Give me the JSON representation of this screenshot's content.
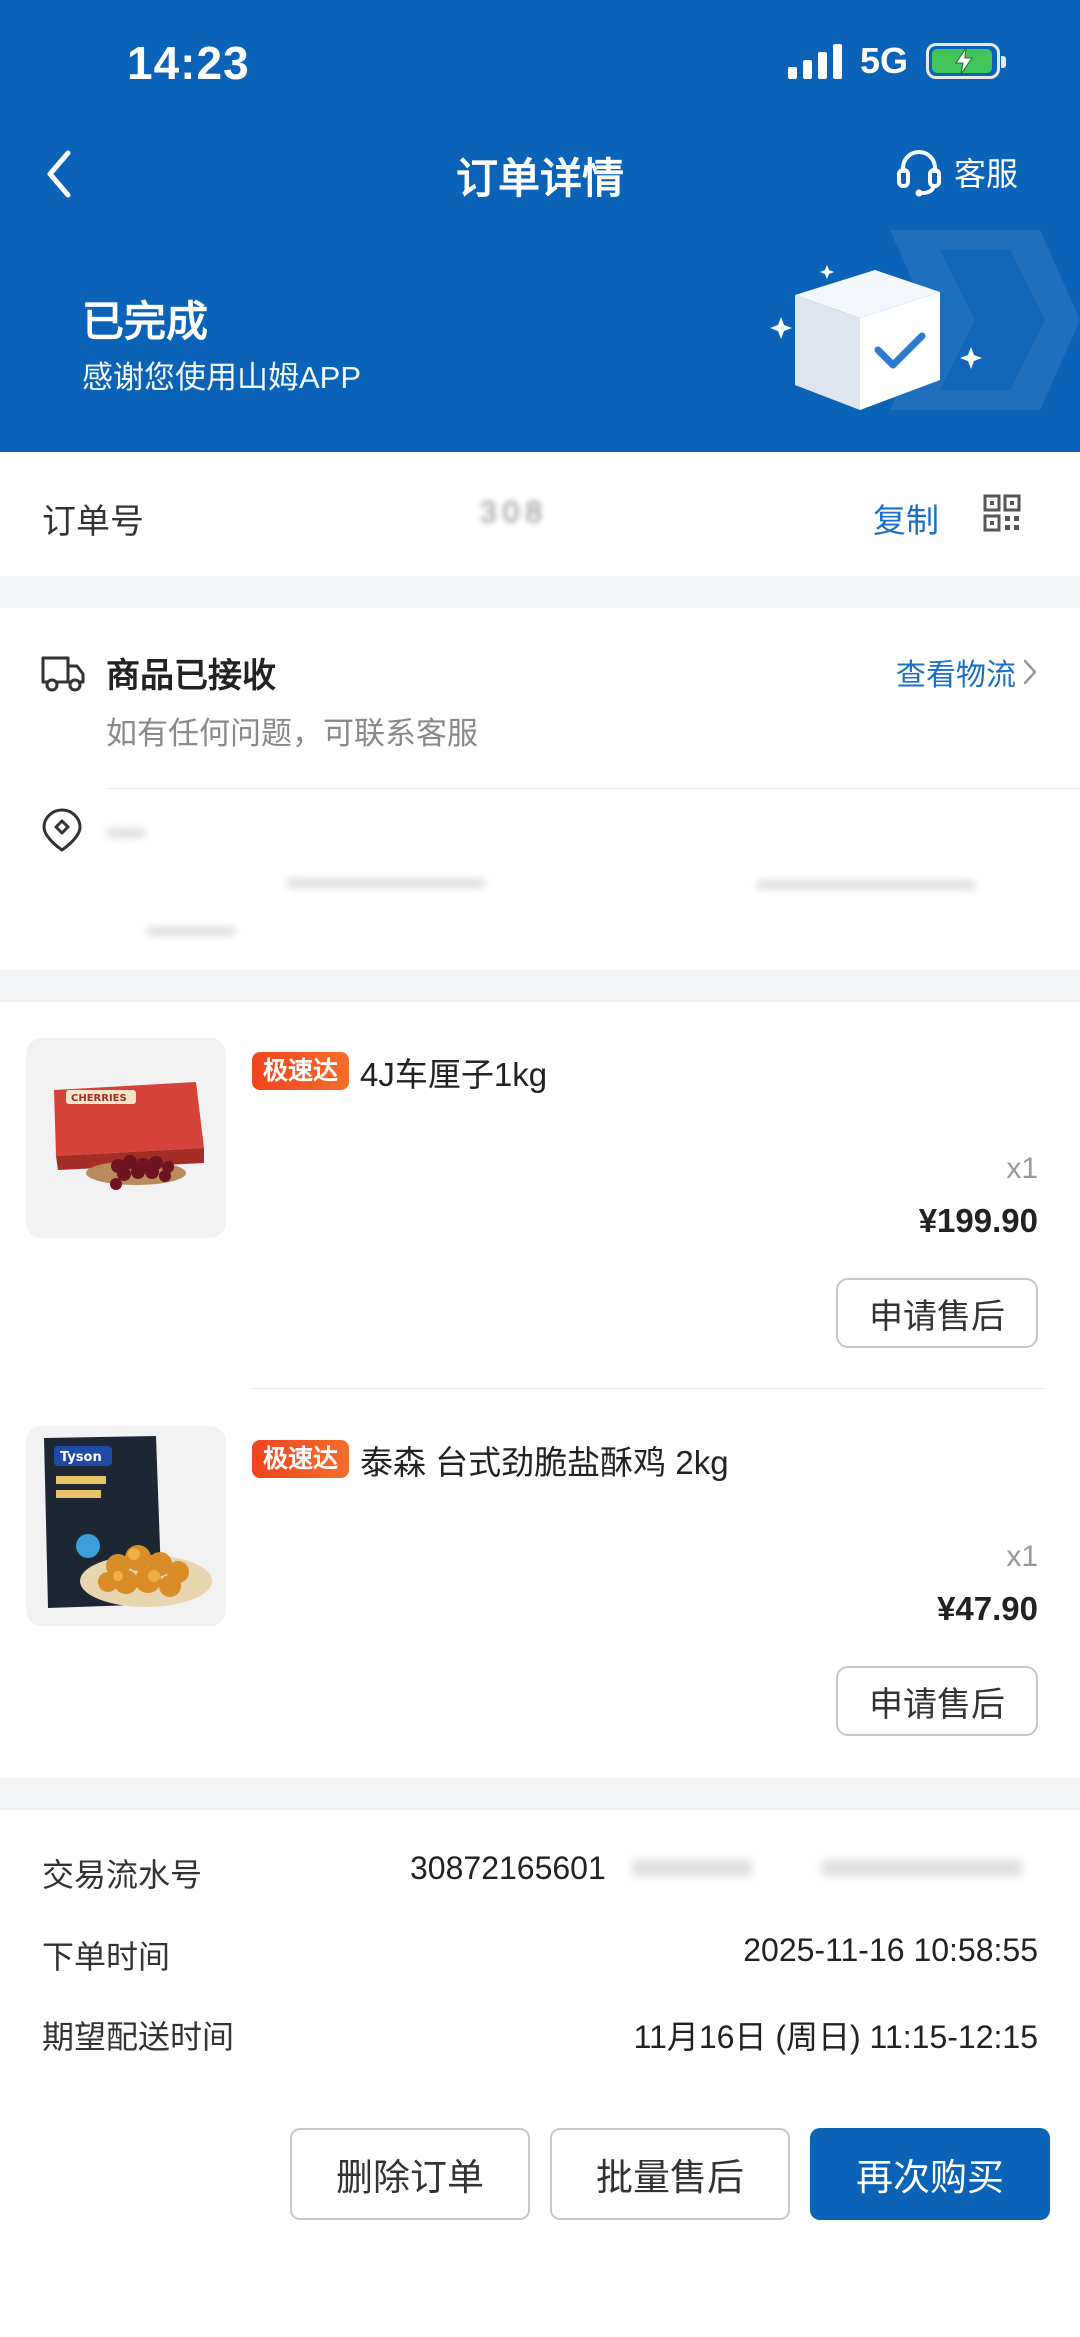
{
  "status_bar": {
    "time": "14:23",
    "network": "5G"
  },
  "nav": {
    "title": "订单详情",
    "service_label": "客服"
  },
  "order_status": {
    "title": "已完成",
    "subtitle": "感谢您使用山姆APP"
  },
  "order_number": {
    "label": "订单号",
    "value": "308",
    "copy_label": "复制"
  },
  "delivery": {
    "title": "商品已接收",
    "subtitle": "如有任何问题，可联系客服",
    "logistics_label": "查看物流"
  },
  "products": [
    {
      "tag": "极速达",
      "name": "4J车厘子1kg",
      "quantity": "x1",
      "price": "¥199.90",
      "action": "申请售后",
      "image_text": "CHERRIES"
    },
    {
      "tag": "极速达",
      "name": "泰森 台式劲脆盐酥鸡 2kg",
      "quantity": "x1",
      "price": "¥47.90",
      "action": "申请售后",
      "image_text": "Tyson"
    }
  ],
  "order_info": [
    {
      "label": "交易流水号",
      "value": "30872165601"
    },
    {
      "label": "下单时间",
      "value": "2025-11-16 10:58:55"
    },
    {
      "label": "期望配送时间",
      "value": "11月16日 (周日) 11:15-12:15"
    }
  ],
  "bottom_actions": {
    "delete": "删除订单",
    "batch_after_sale": "批量售后",
    "rebuy": "再次购买"
  },
  "colors": {
    "brand_blue": "#0a63b7",
    "link_blue": "#1a6fc8",
    "tag_orange": "#f0441f"
  }
}
